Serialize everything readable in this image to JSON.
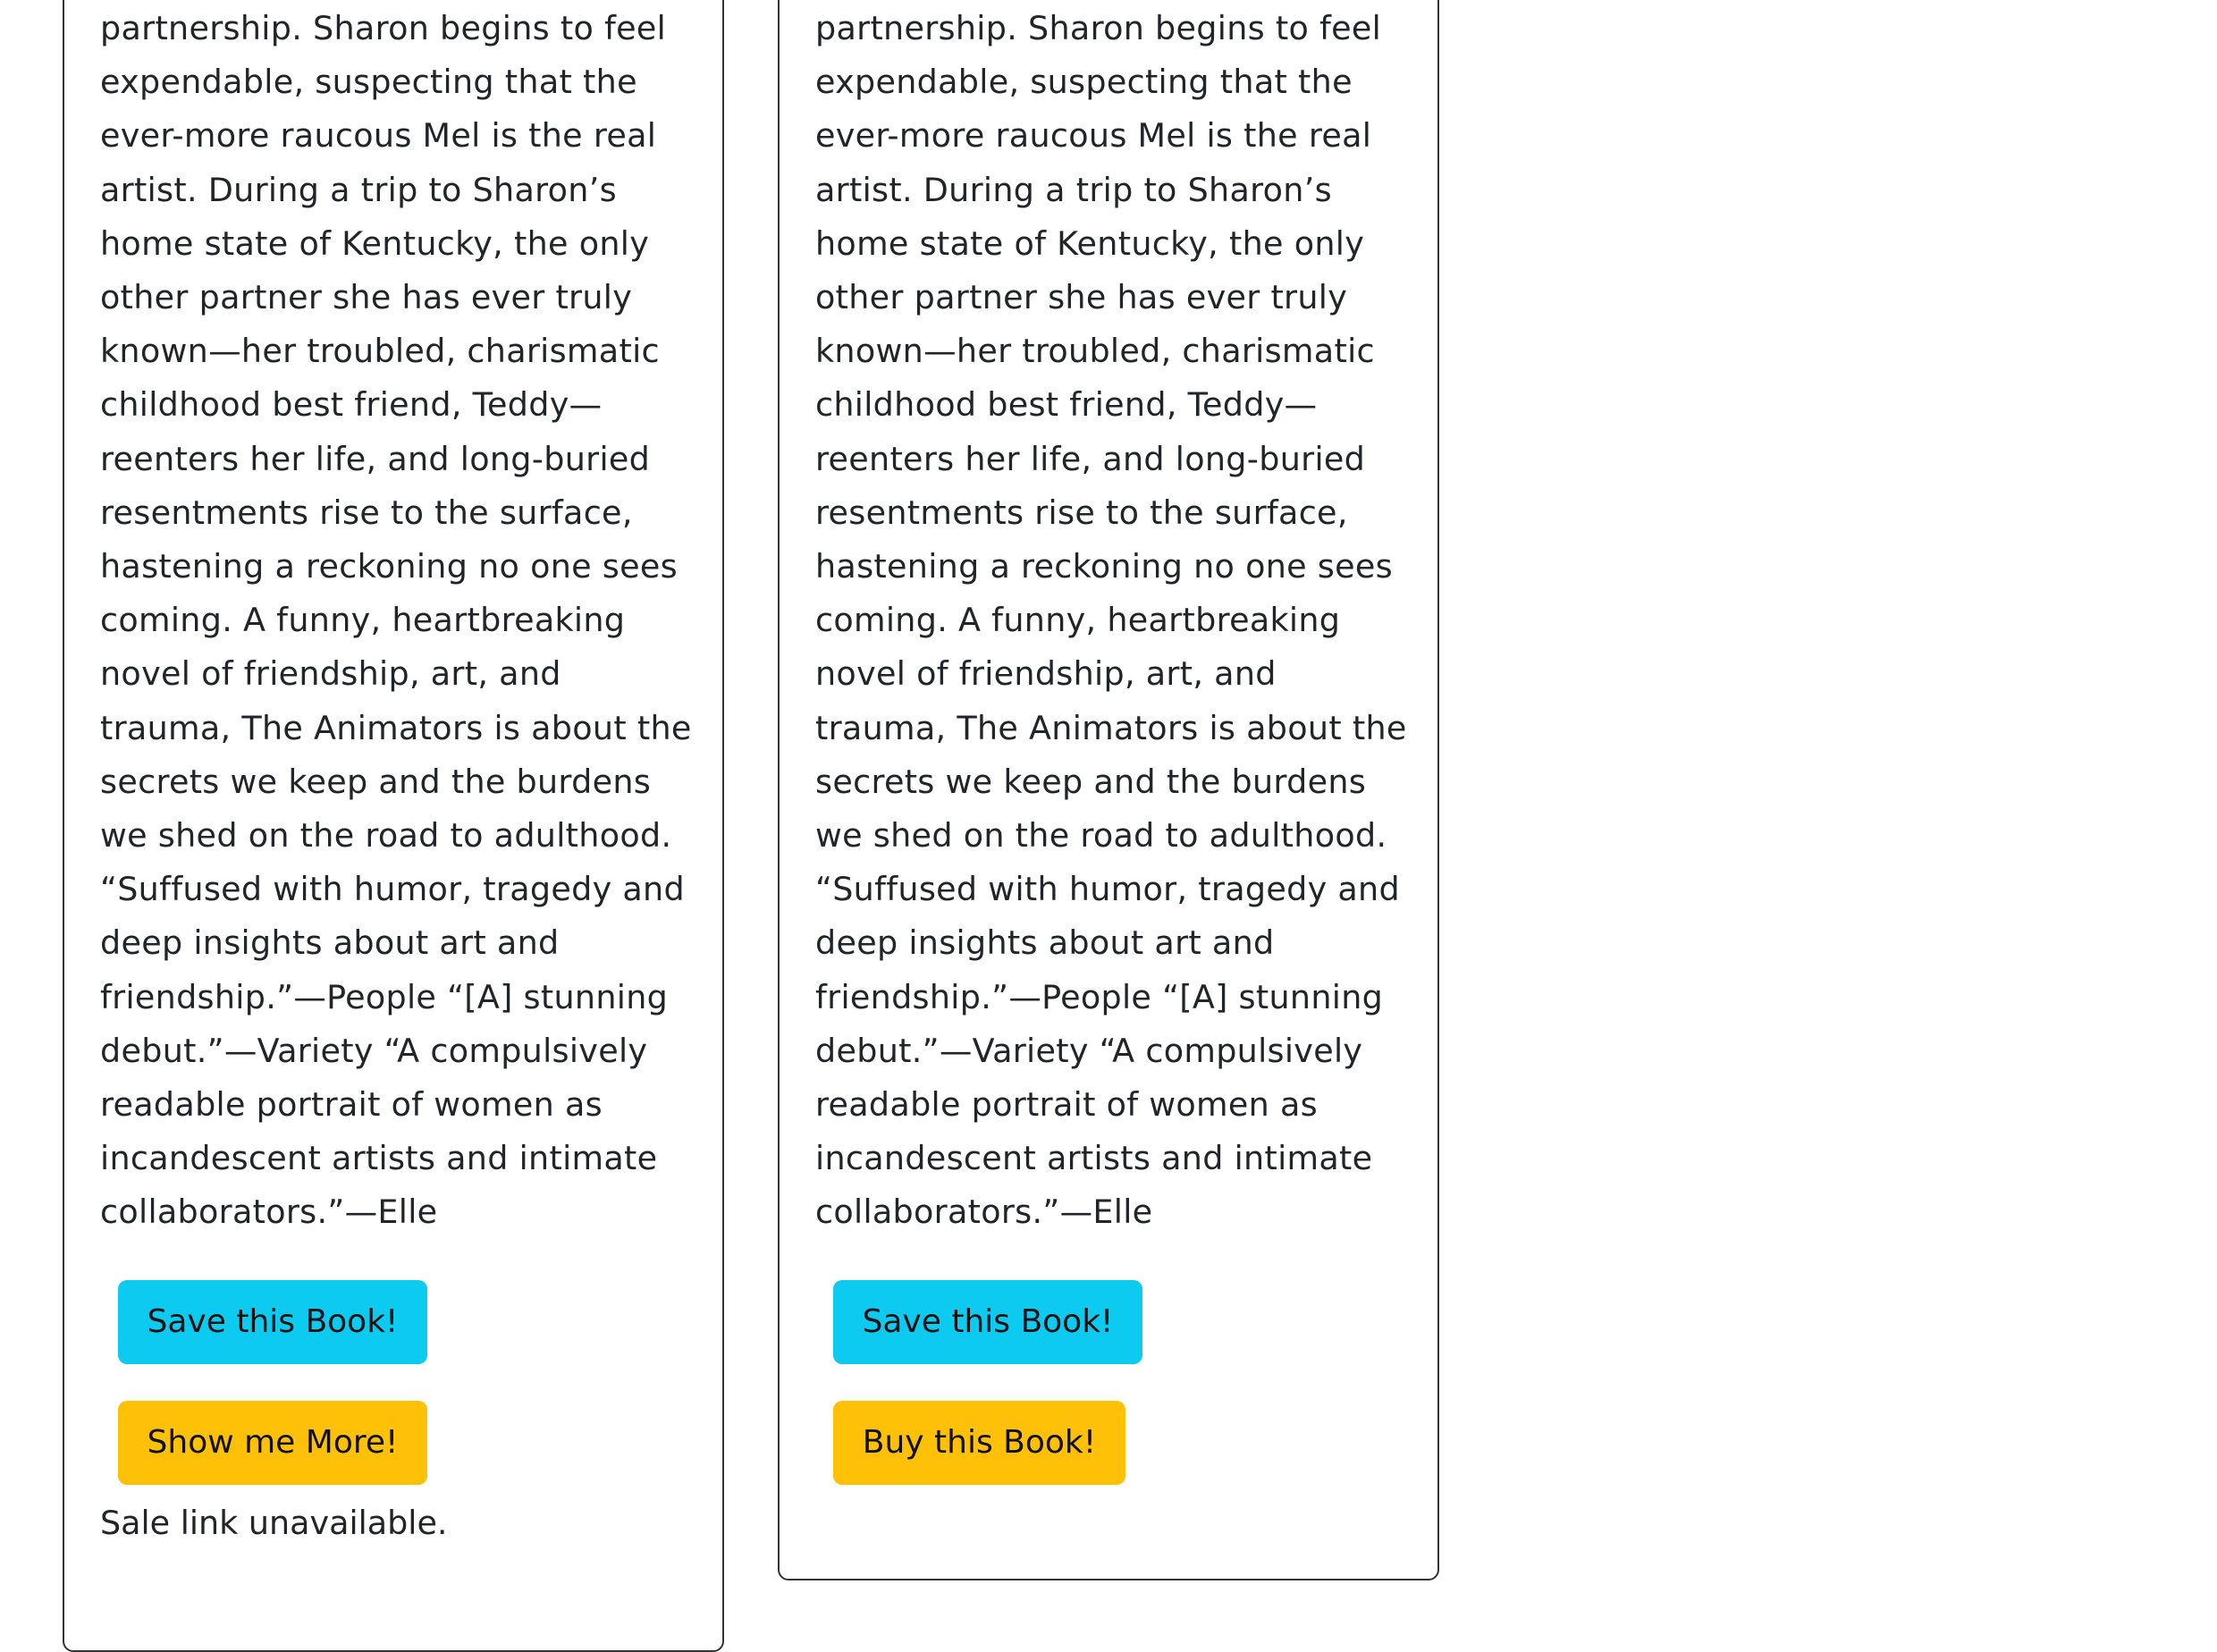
{
  "cards": [
    {
      "description_lines": [
        "partnership. Sharon begins to feel",
        "expendable, suspecting that the",
        "ever-more raucous Mel is the real",
        "artist. During a trip to Sharon’s",
        "home state of Kentucky, the only",
        "other partner she has ever truly",
        "known—her troubled, charismatic",
        "childhood best friend, Teddy—",
        "reenters her life, and long-buried",
        "resentments rise to the surface,",
        "hastening a reckoning no one sees",
        "coming. A funny, heartbreaking",
        "novel of friendship, art, and",
        "trauma, The Animators is about the",
        "secrets we keep and the burdens",
        "we shed on the road to adulthood.",
        "“Suffused with humor, tragedy and",
        "deep insights about art and",
        "friendship.”—People “[A] stunning",
        "debut.”—Variety “A compulsively",
        "readable portrait of women as",
        "incandescent artists and intimate",
        "collaborators.”—Elle"
      ],
      "save_label": "Save this Book!",
      "more_label": "Show me More!",
      "sale_status": "Sale link unavailable."
    },
    {
      "description_lines": [
        "partnership. Sharon begins to feel",
        "expendable, suspecting that the",
        "ever-more raucous Mel is the real",
        "artist. During a trip to Sharon’s",
        "home state of Kentucky, the only",
        "other partner she has ever truly",
        "known—her troubled, charismatic",
        "childhood best friend, Teddy—",
        "reenters her life, and long-buried",
        "resentments rise to the surface,",
        "hastening a reckoning no one sees",
        "coming. A funny, heartbreaking",
        "novel of friendship, art, and",
        "trauma, The Animators is about the",
        "secrets we keep and the burdens",
        "we shed on the road to adulthood.",
        "“Suffused with humor, tragedy and",
        "deep insights about art and",
        "friendship.”—People “[A] stunning",
        "debut.”—Variety “A compulsively",
        "readable portrait of women as",
        "incandescent artists and intimate",
        "collaborators.”—Elle"
      ],
      "save_label": "Save this Book!",
      "buy_label": "Buy this Book!"
    }
  ],
  "colors": {
    "save_button": "#0dcaf0",
    "secondary_button": "#ffc107",
    "card_border": "#333333"
  }
}
